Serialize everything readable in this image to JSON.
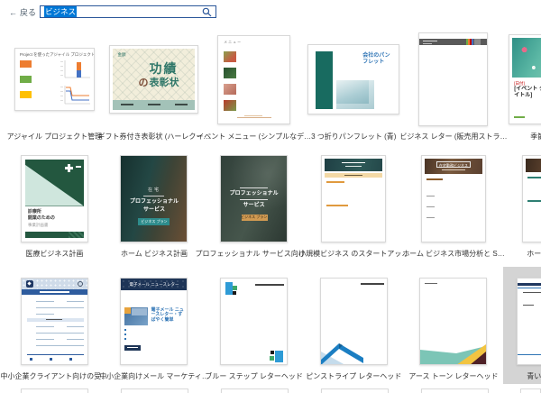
{
  "header": {
    "back_label": "戻る",
    "search_value": "ビジネス",
    "accent_color": "#2b579a",
    "selection_color": "#0078d7"
  },
  "templates": [
    {
      "label": "アジャイル プロジェクト管理",
      "thumb": {
        "title": "Project を使ったアジャイル プロジェクトの管理"
      }
    },
    {
      "label": "ギフト券付き表彰状 (ハーレクー…",
      "thumb": {
        "corner": "金額",
        "title_top": "功績",
        "title_no": "の",
        "title_bottom": "表彰状"
      }
    },
    {
      "label": "イベント メニュー (シンプルなデ…",
      "thumb": {
        "corner": "メニュー"
      }
    },
    {
      "label": "3 つ折りパンフレット (青)",
      "thumb": {
        "title": "会社のパンフレット"
      }
    },
    {
      "label": "ビジネス レター (販売用ストラ…",
      "thumb": {}
    },
    {
      "label": "季節",
      "thumb": {
        "date": "[日付]",
        "title": "[イベント タイトル]"
      }
    },
    {
      "label": "医療ビジネス計画",
      "thumb": {
        "line1": "診療所",
        "line2": "開業のための",
        "line3": "事業計画書"
      }
    },
    {
      "label": "ホーム ビジネス計画",
      "thumb": {
        "eyebrow": "在宅",
        "title1": "プロフェッショナル",
        "title2": "サービス",
        "button": "ビジネス プラン"
      }
    },
    {
      "label": "プロフェッショナル サービス向け…",
      "thumb": {
        "title1": "プロフェッショナル",
        "title2": "サービス",
        "button": "ビジネス プラン"
      }
    },
    {
      "label": "小規模ビジネス のスタートアッ…",
      "thumb": {}
    },
    {
      "label": "ホーム ビジネス市場分析と S…",
      "thumb": {
        "box_title": "在宅勤務ビジネス"
      }
    },
    {
      "label": "ホーム ビ",
      "thumb": {}
    },
    {
      "label": "中小企業クライアント向けの受…",
      "thumb": {}
    },
    {
      "label": "中小企業向けメール マーケティ…",
      "thumb": {
        "header": "電子メール ニュースレター",
        "feature": "電子メール ニュースレター・すばやく簡単"
      }
    },
    {
      "label": "ブルー ステップ レターヘッド",
      "thumb": {}
    },
    {
      "label": "ピンストライプ レターヘッド",
      "thumb": {}
    },
    {
      "label": "アース トーン レターヘッド",
      "thumb": {}
    },
    {
      "label": "青い",
      "thumb": {}
    }
  ]
}
